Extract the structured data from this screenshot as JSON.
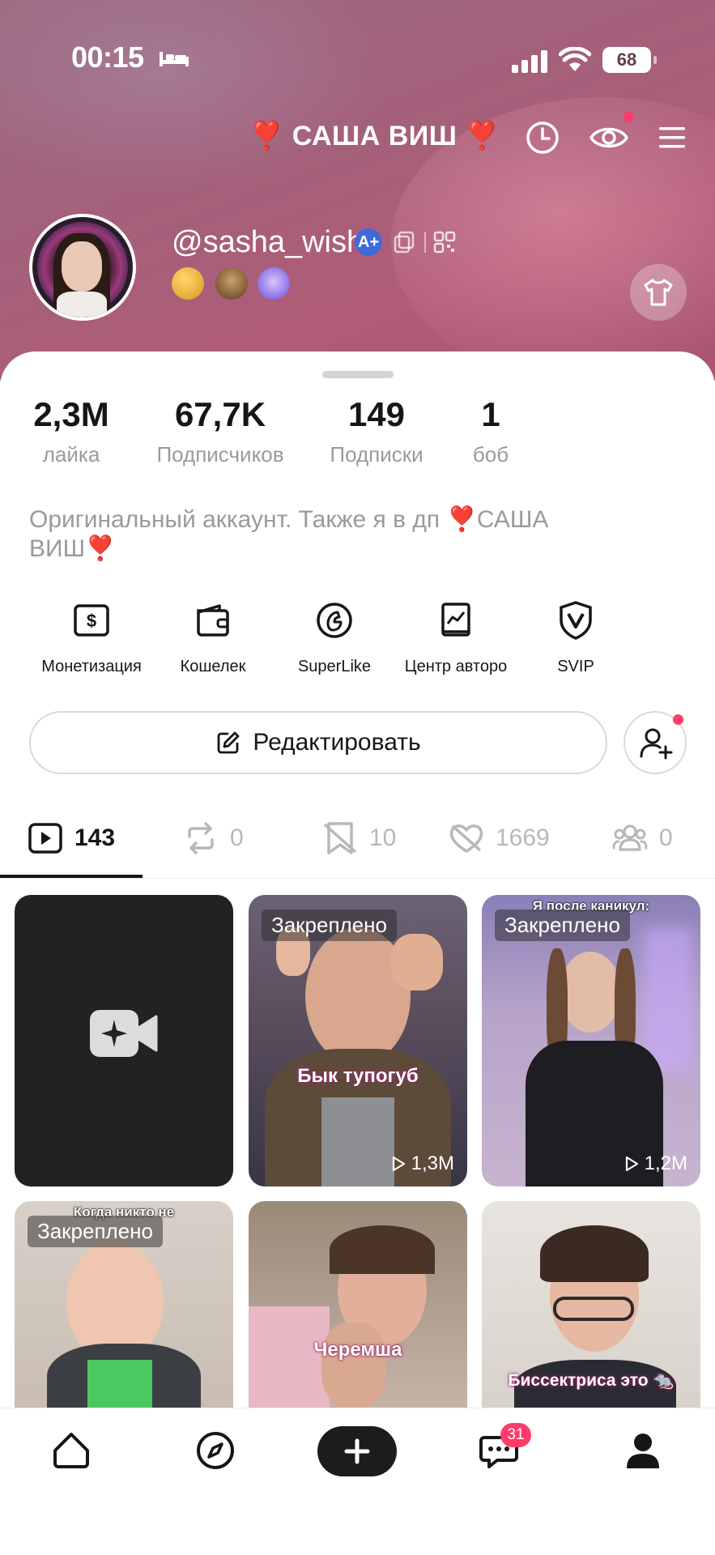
{
  "status_bar": {
    "time": "00:15",
    "battery": "68"
  },
  "header": {
    "title": "❣️ САША ВИШ ❣️"
  },
  "profile": {
    "handle": "@sasha_wish",
    "verified_label": "A+"
  },
  "stats": [
    {
      "value": "2,3M",
      "label": "лайка"
    },
    {
      "value": "67,7K",
      "label": "Подписчиков"
    },
    {
      "value": "149",
      "label": "Подписки"
    },
    {
      "value": "1",
      "label": "боб"
    }
  ],
  "bio": "Оригинальный аккаунт. Также я в дп ❣️САША ВИШ❣️",
  "tools": [
    {
      "label": "Монетизация",
      "icon": "dollar-icon"
    },
    {
      "label": "Кошелек",
      "icon": "wallet-icon"
    },
    {
      "label": "SuperLike",
      "icon": "superlike-icon"
    },
    {
      "label": "Центр авторо",
      "icon": "creator-center-icon"
    },
    {
      "label": "SVIP",
      "icon": "svip-icon"
    }
  ],
  "edit_button": "Редактировать",
  "tabs": [
    {
      "name": "videos",
      "count": "143",
      "icon": "play-icon"
    },
    {
      "name": "reposts",
      "count": "0",
      "icon": "repost-icon"
    },
    {
      "name": "favorites",
      "count": "10",
      "icon": "bookmark-icon"
    },
    {
      "name": "likes",
      "count": "1669",
      "icon": "heart-icon"
    },
    {
      "name": "friends",
      "count": "0",
      "icon": "group-icon"
    }
  ],
  "videos": [
    {
      "pinned_label": "",
      "views": "",
      "caption": "",
      "top_caption": ""
    },
    {
      "pinned_label": "Закреплено",
      "views": "1,3M",
      "caption": "Бык тупогуб",
      "top_caption": ""
    },
    {
      "pinned_label": "Закреплено",
      "views": "1,2M",
      "caption": "",
      "top_caption": "Я после каникул:"
    },
    {
      "pinned_label": "Закреплено",
      "views": "",
      "caption": "",
      "top_caption": "Когда никто не"
    },
    {
      "pinned_label": "",
      "views": "",
      "caption": "Черемша",
      "top_caption": ""
    },
    {
      "pinned_label": "",
      "views": "",
      "caption": "Биссектриса это 🐀",
      "top_caption": ""
    }
  ],
  "bottom_nav": {
    "messages_badge": "31"
  },
  "colors": {
    "accent": "#ff3b6b",
    "header": "#a4607a"
  }
}
